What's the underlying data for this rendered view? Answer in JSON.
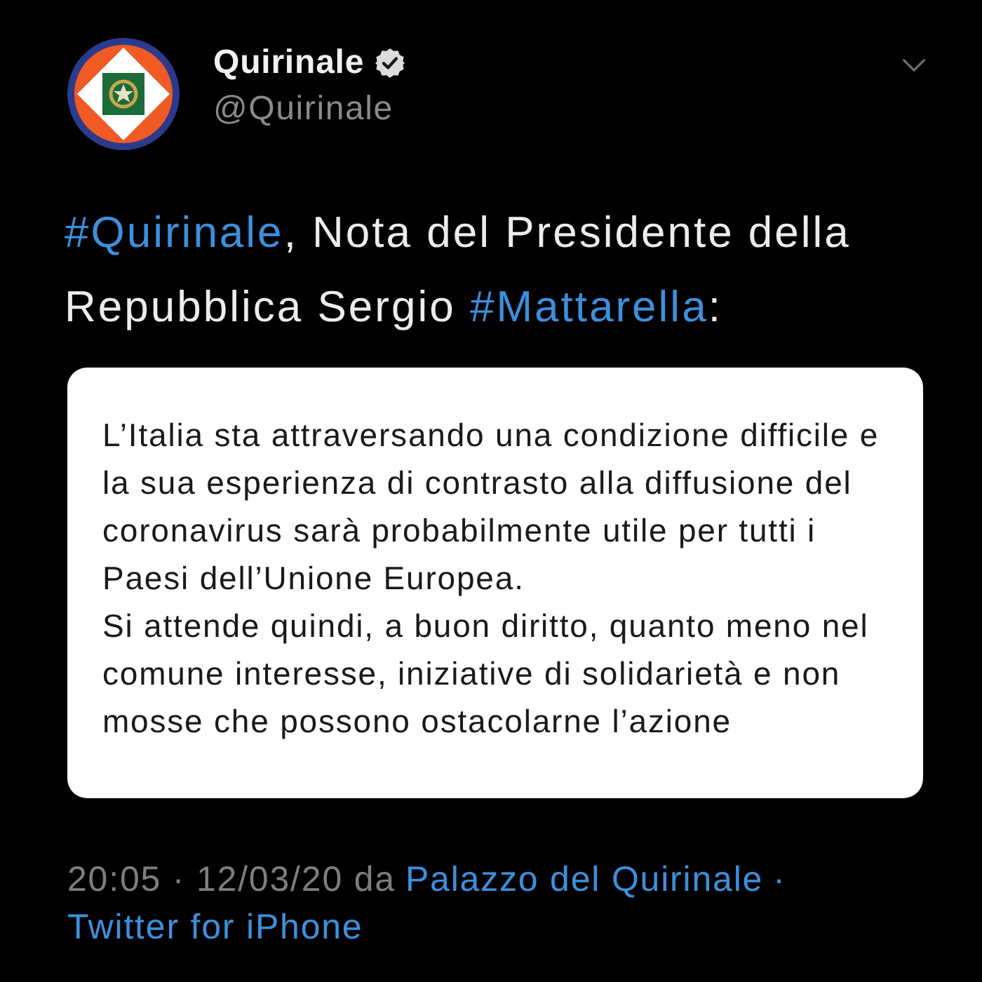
{
  "account": {
    "name": "Quirinale",
    "verified": true,
    "handle": "@Quirinale"
  },
  "tweet": {
    "segments": [
      {
        "kind": "hashtag",
        "text": "#Quirinale"
      },
      {
        "kind": "plain",
        "text": ", Nota del Presidente della Repubblica Sergio "
      },
      {
        "kind": "hashtag",
        "text": "#Mattarella"
      },
      {
        "kind": "plain",
        "text": ":"
      }
    ]
  },
  "quote_card": {
    "paragraphs": [
      "L’Italia sta attraversando una condizione difficile e la sua esperienza di contrasto alla diffusione del coronavirus sarà probabilmente utile per tutti i Paesi dell’Unione Europea.",
      "Si attende quindi, a buon diritto, quanto meno nel comune interesse, iniziative di solidarietà e non mosse che possono ostacolarne l’azione"
    ]
  },
  "footer": {
    "segments": [
      {
        "kind": "meta",
        "text": "20:05 · 12/03/20 da"
      },
      {
        "kind": "link",
        "text": "Palazzo del Quirinale"
      },
      {
        "kind": "separator",
        "text": "·"
      },
      {
        "kind": "link",
        "text": "Twitter for iPhone"
      }
    ]
  }
}
